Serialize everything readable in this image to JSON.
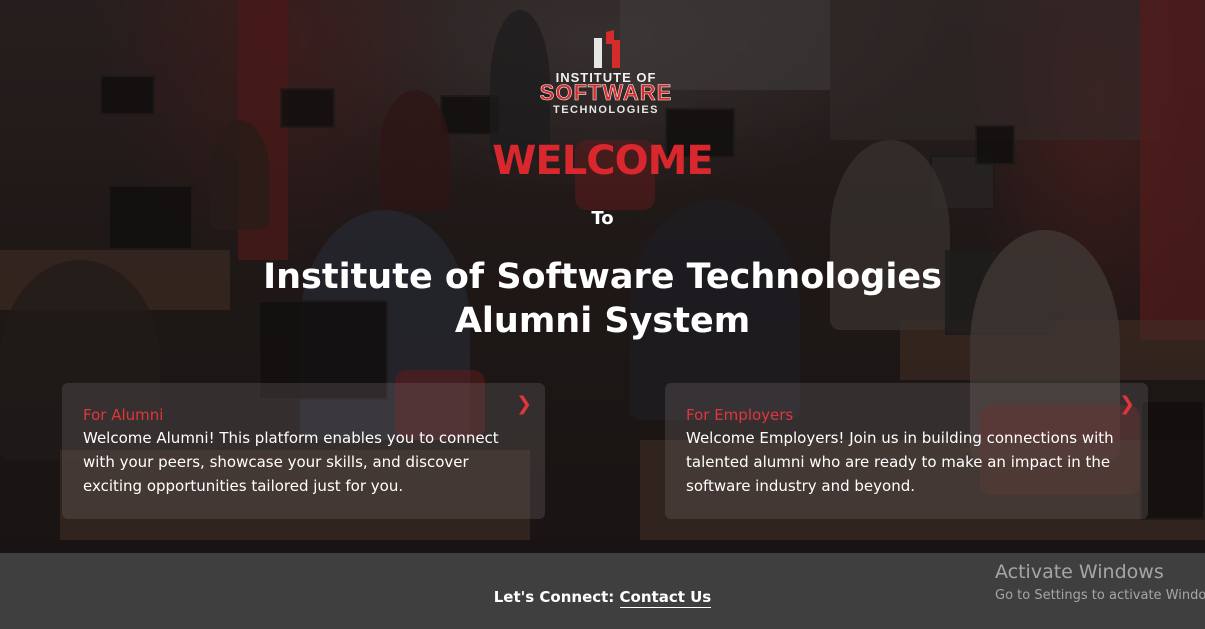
{
  "logo": {
    "line1": "INSTITUTE OF",
    "line2": "SOFTWARE",
    "line3": "TECHNOLOGIES",
    "brand_red": "#d52b2b"
  },
  "hero": {
    "welcome": "WELCOME",
    "to": "To",
    "title_line1": "Institute of Software Technologies",
    "title_line2": "Alumni System",
    "accent_color": "#d8282d"
  },
  "cards": {
    "alumni": {
      "title": "For Alumni",
      "text": "Welcome Alumni! This platform enables you to connect with your peers, showcase your skills, and discover exciting opportunities tailored just for you.",
      "icon": "chevron-right-icon"
    },
    "employers": {
      "title": "For Employers",
      "text": "Welcome Employers! Join us in building connections with talented alumni who are ready to make an impact in the software industry and beyond.",
      "icon": "chevron-right-icon"
    }
  },
  "footer": {
    "connect_label": "Let's Connect:",
    "contact_link": "Contact Us",
    "background": "#403f3f"
  },
  "watermark": {
    "title": "Activate Windows",
    "subtitle": "Go to Settings to activate Windows."
  }
}
